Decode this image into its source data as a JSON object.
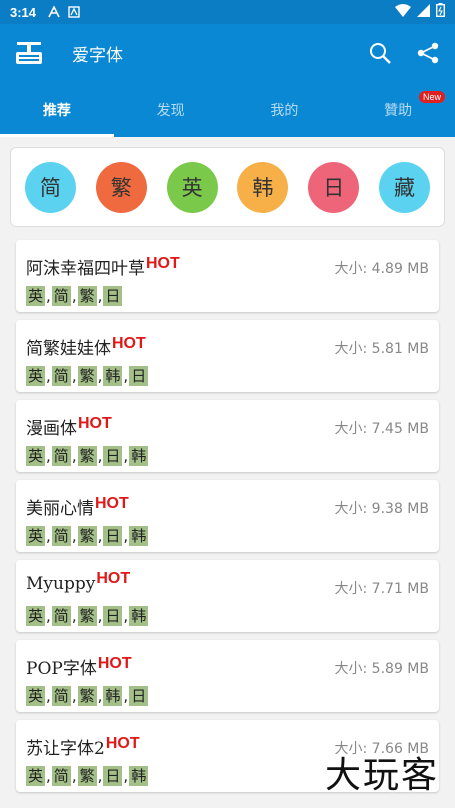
{
  "status_bar": {
    "time": "3:14"
  },
  "app_bar": {
    "title": "爱字体"
  },
  "tabs": [
    {
      "label": "推荐",
      "active": true
    },
    {
      "label": "发现",
      "active": false
    },
    {
      "label": "我的",
      "active": false
    },
    {
      "label": "贊助",
      "active": false,
      "badge": "New"
    }
  ],
  "languages": [
    {
      "label": "简",
      "color": "#5bd3f0"
    },
    {
      "label": "繁",
      "color": "#ef6a3e"
    },
    {
      "label": "英",
      "color": "#7bc94a"
    },
    {
      "label": "韩",
      "color": "#f7b048"
    },
    {
      "label": "日",
      "color": "#ee6478"
    },
    {
      "label": "藏",
      "color": "#5bd3f0"
    }
  ],
  "fonts": [
    {
      "name": "阿沫幸福四叶草",
      "hot": "HOT",
      "size": "大小: 4.89 MB",
      "tags": [
        "英",
        "简",
        "繁",
        "日"
      ]
    },
    {
      "name": "简繁娃娃体",
      "hot": "HOT",
      "size": "大小: 5.81 MB",
      "tags": [
        "英",
        "简",
        "繁",
        "韩",
        "日"
      ]
    },
    {
      "name": "漫画体",
      "hot": "HOT",
      "size": "大小: 7.45 MB",
      "tags": [
        "英",
        "简",
        "繁",
        "日",
        "韩"
      ]
    },
    {
      "name": "美丽心情",
      "hot": "HOT",
      "size": "大小: 9.38 MB",
      "tags": [
        "英",
        "简",
        "繁",
        "日",
        "韩"
      ]
    },
    {
      "name": "Myuppy",
      "hot": "HOT",
      "size": "大小: 7.71 MB",
      "tags": [
        "英",
        "简",
        "繁",
        "日",
        "韩"
      ]
    },
    {
      "name": "POP字体",
      "hot": "HOT",
      "size": "大小: 5.89 MB",
      "tags": [
        "英",
        "简",
        "繁",
        "韩",
        "日"
      ]
    },
    {
      "name": "苏让字体2",
      "hot": "HOT",
      "size": "大小: 7.66 MB",
      "tags": [
        "英",
        "简",
        "繁",
        "日",
        "韩"
      ]
    }
  ],
  "watermark": "大玩客",
  "colors": {
    "primary": "#0a88d4",
    "status_bar": "#0a7dc4",
    "hot": "#e01818",
    "tag_bg": "#a3c088"
  }
}
